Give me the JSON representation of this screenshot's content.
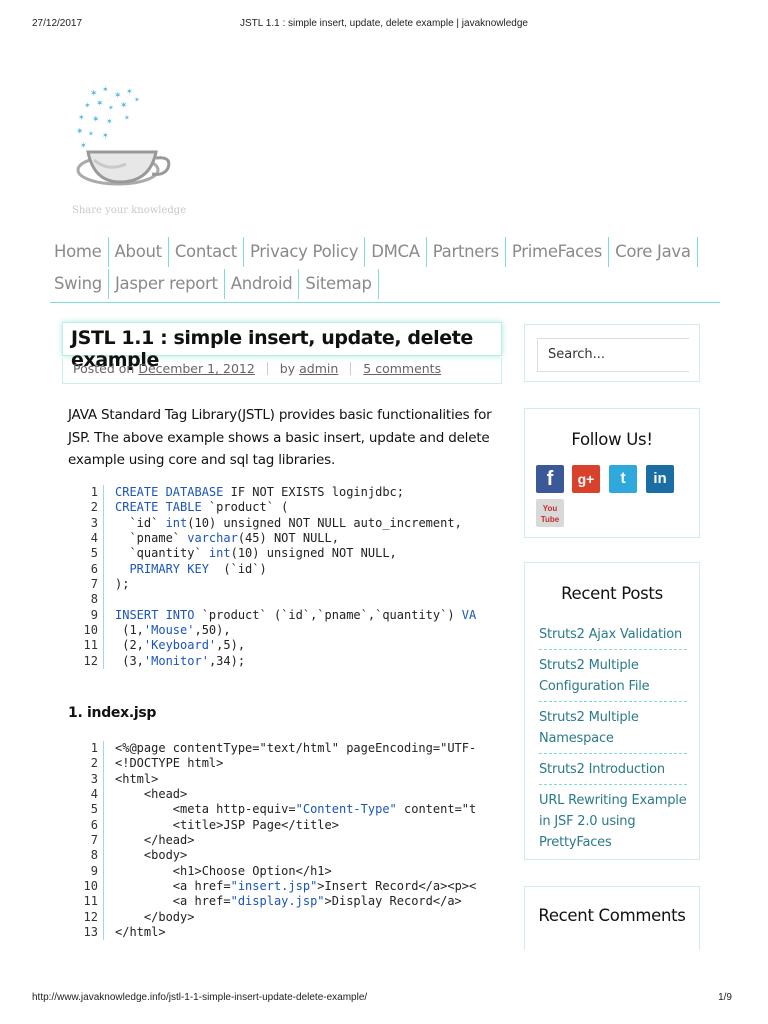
{
  "print": {
    "date": "27/12/2017",
    "title": "JSTL 1.1 : simple insert, update, delete example | javaknowledge",
    "url": "http://www.javaknowledge.info/jstl-1-1-simple-insert-update-delete-example/",
    "pages": "1/9"
  },
  "site": {
    "tagline": "Share your knowledge"
  },
  "nav": {
    "row1": [
      "Home",
      "About",
      "Contact",
      "Privacy Policy",
      "DMCA",
      "Partners",
      "PrimeFaces",
      "Core Java"
    ],
    "row2": [
      "Swing",
      "Jasper report",
      "Android",
      "Sitemap"
    ]
  },
  "post": {
    "title": "JSTL 1.1 : simple insert, update, delete example",
    "posted_on_label": "Posted on",
    "date": "December 1, 2012",
    "by_label": "by",
    "author": "admin",
    "comments": "5 comments",
    "intro": "JAVA Standard Tag Library(JSTL) provides basic functionalities for JSP. The above example shows a basic insert, update and delete example using core and sql tag libraries.",
    "section1": "1. index.jsp"
  },
  "code_sql": [
    [
      {
        "t": "CREATE DATABASE",
        "c": "kw"
      },
      {
        "t": " IF NOT EXISTS loginjdbc;"
      }
    ],
    [
      {
        "t": "CREATE TABLE",
        "c": "kw"
      },
      {
        "t": " `product` ("
      }
    ],
    [
      {
        "t": "  `id` "
      },
      {
        "t": "int",
        "c": "kw"
      },
      {
        "t": "(10) unsigned NOT NULL auto_increment,"
      }
    ],
    [
      {
        "t": "  `pname` "
      },
      {
        "t": "varchar",
        "c": "kw"
      },
      {
        "t": "(45) NOT NULL,"
      }
    ],
    [
      {
        "t": "  `quantity` "
      },
      {
        "t": "int",
        "c": "kw"
      },
      {
        "t": "(10) unsigned NOT NULL,"
      }
    ],
    [
      {
        "t": "  "
      },
      {
        "t": "PRIMARY KEY",
        "c": "kw"
      },
      {
        "t": "  (`id`)"
      }
    ],
    [
      {
        "t": ");"
      }
    ],
    [
      {
        "t": ""
      }
    ],
    [
      {
        "t": "INSERT INTO",
        "c": "kw"
      },
      {
        "t": " `product` (`id`,`pname`,`quantity`) "
      },
      {
        "t": "VA",
        "c": "kw"
      }
    ],
    [
      {
        "t": " (1,"
      },
      {
        "t": "'Mouse'",
        "c": "str"
      },
      {
        "t": ",50),"
      }
    ],
    [
      {
        "t": " (2,"
      },
      {
        "t": "'Keyboard'",
        "c": "str"
      },
      {
        "t": ",5),"
      }
    ],
    [
      {
        "t": " (3,"
      },
      {
        "t": "'Monitor'",
        "c": "str"
      },
      {
        "t": ",34);"
      }
    ]
  ],
  "code_jsp": [
    [
      {
        "t": "<%@page contentType=\"text/html\" pageEncoding=\"UTF-"
      }
    ],
    [
      {
        "t": "<!DOCTYPE html>"
      }
    ],
    [
      {
        "t": "<html>"
      }
    ],
    [
      {
        "t": "    <head>"
      }
    ],
    [
      {
        "t": "        <meta http-equiv="
      },
      {
        "t": "\"Content-Type\"",
        "c": "str"
      },
      {
        "t": " content=\"t"
      }
    ],
    [
      {
        "t": "        <title>JSP Page</title>"
      }
    ],
    [
      {
        "t": "    </head>"
      }
    ],
    [
      {
        "t": "    <body>"
      }
    ],
    [
      {
        "t": "        <h1>Choose Option</h1>"
      }
    ],
    [
      {
        "t": "        <a href="
      },
      {
        "t": "\"insert.jsp\"",
        "c": "str"
      },
      {
        "t": ">Insert Record</a><p><"
      }
    ],
    [
      {
        "t": "        <a href="
      },
      {
        "t": "\"display.jsp\"",
        "c": "str"
      },
      {
        "t": ">Display Record</a>"
      }
    ],
    [
      {
        "t": "    </body>"
      }
    ],
    [
      {
        "t": "</html>"
      }
    ]
  ],
  "sidebar": {
    "search_placeholder": "Search...",
    "follow_title": "Follow Us!",
    "social": {
      "fb": "f",
      "gp": "g+",
      "tw": "t",
      "li": "in",
      "yt": "You Tube"
    },
    "recent_title": "Recent Posts",
    "recent_posts": [
      "Struts2 Ajax Validation",
      "Struts2 Multiple Configuration File",
      "Struts2 Multiple Namespace",
      "Struts2 Introduction",
      "URL Rewriting Example in JSF 2.0 using PrettyFaces"
    ],
    "comments_title": "Recent Comments"
  }
}
